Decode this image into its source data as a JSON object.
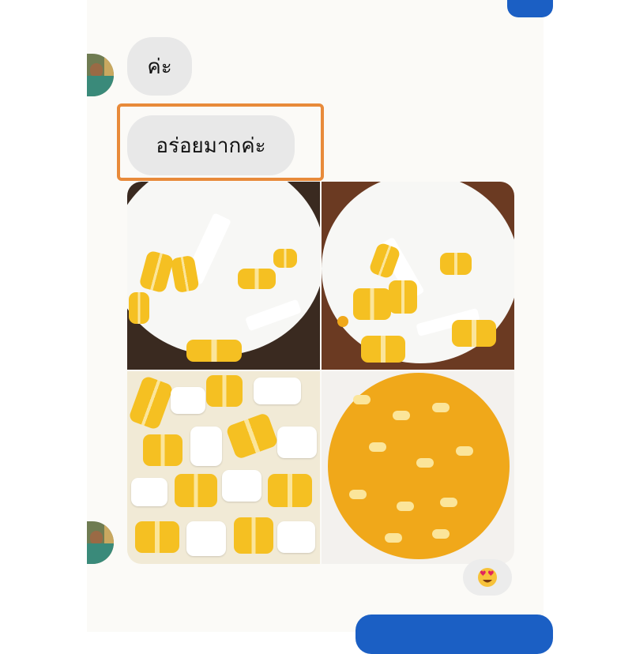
{
  "messages": [
    {
      "text": "ค่ะ"
    },
    {
      "text": "อร่อยมากค่ะ"
    }
  ],
  "photos": [
    {
      "content": "bowl-coconut-milk-corn-dessert"
    },
    {
      "content": "bowl-coconut-milk-corn-dessert"
    },
    {
      "content": "yellow-white-dumplings"
    },
    {
      "content": "sweet-corn-kernels"
    }
  ],
  "reaction": {
    "icon": "heart-eyes-emoji"
  },
  "colors": {
    "highlight": "#e88a3a",
    "bubble": "#e8e8e8",
    "accent": "#1b5fc4"
  }
}
